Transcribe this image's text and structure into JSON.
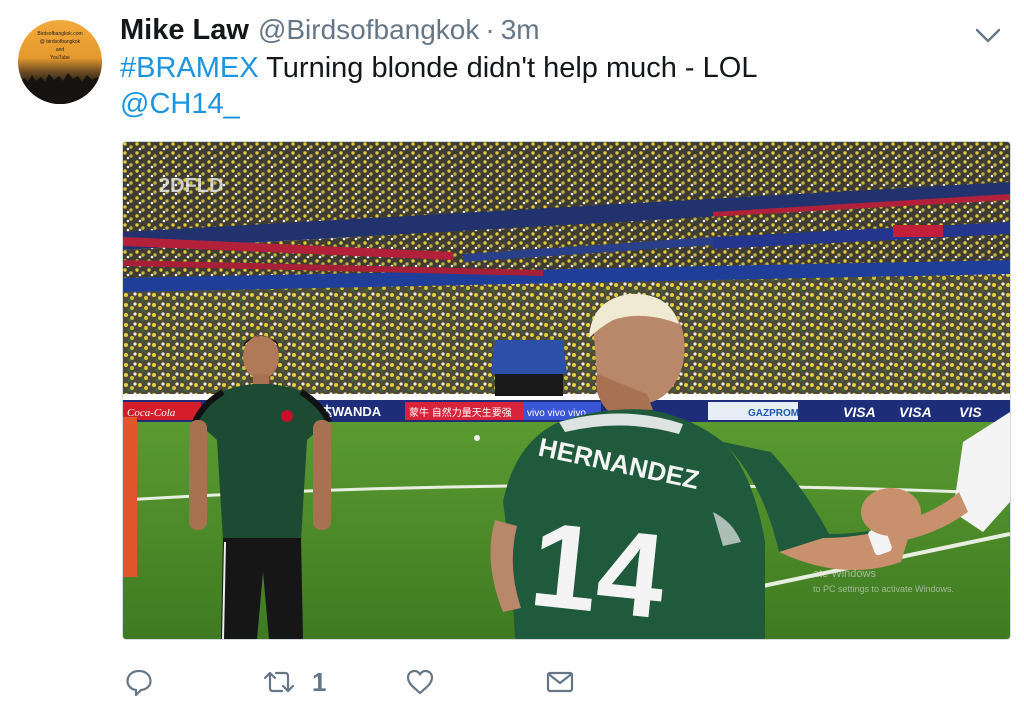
{
  "tweet": {
    "display_name": "Mike Law",
    "handle": "@Birdsofbangkok",
    "separator": "·",
    "timestamp": "3m",
    "hashtag": "#BRAMEX",
    "text": " Turning blonde didn't help much - LOL",
    "mention": "@CH14_"
  },
  "avatar": {
    "line1": "Birdsofbangkok.com",
    "line2": "@ birdsofbangkok",
    "line3": "and",
    "line4": "YouTube"
  },
  "media": {
    "channel_logo": "2DFLD",
    "player_number": "14",
    "player_name": "HERNANDEZ",
    "ads": [
      "Coca-Cola",
      "万达WANDA",
      "蒙牛 自然力量天生要强",
      "vivo vivo vivo",
      "GAZPROM",
      "VISA",
      "VISA",
      "VIS"
    ],
    "watermark_line1": "ate Windows",
    "watermark_line2": "to PC settings to activate Windows."
  },
  "actions": {
    "reply_icon": "reply-icon",
    "retweet_icon": "retweet-icon",
    "retweet_count": "1",
    "like_icon": "heart-icon",
    "dm_icon": "envelope-icon",
    "more_icon": "chevron-down-icon"
  },
  "colors": {
    "link": "#1b95e0",
    "text": "#14171a",
    "secondary": "#657786",
    "jersey_green": "#1f5a3c",
    "pitch": "#4f8a2a"
  }
}
